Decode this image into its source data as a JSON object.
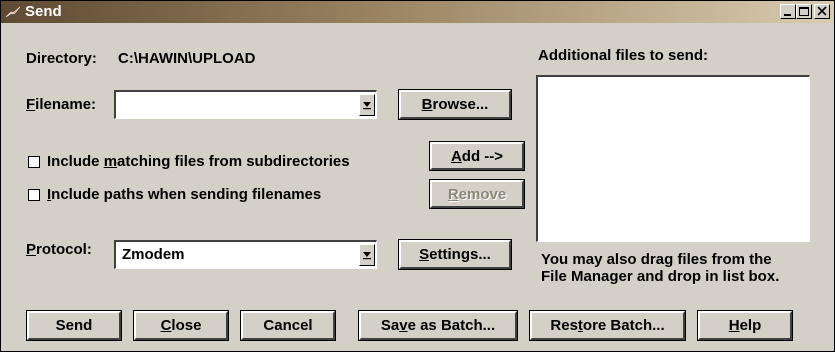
{
  "window": {
    "title": "Send",
    "controls": [
      "minimize",
      "maximize",
      "close"
    ]
  },
  "directory": {
    "label": "Directory:",
    "value": "C:\\HAWIN\\UPLOAD"
  },
  "filename": {
    "label_mnemonic": "F",
    "label_rest": "ilename:",
    "value": ""
  },
  "buttons": {
    "browse": {
      "m": "B",
      "rest": "rowse..."
    },
    "add": {
      "m": "A",
      "rest": "dd -->"
    },
    "remove": {
      "m": "R",
      "rest": "emove"
    },
    "settings": {
      "m": "S",
      "rest": "ettings..."
    }
  },
  "options": {
    "matching": {
      "pre": "Include ",
      "m": "m",
      "rest": "atching files from subdirectories",
      "checked": false
    },
    "paths": {
      "pre": "",
      "m": "I",
      "rest": "nclude paths when sending filenames",
      "checked": false
    }
  },
  "protocol": {
    "label_mnemonic": "P",
    "label_rest": "rotocol:",
    "value": "Zmodem"
  },
  "additional": {
    "label": "Additional files to send:",
    "items": [],
    "hint_line1": "You may also drag files from the",
    "hint_line2": "File Manager and drop in list box."
  },
  "bottom": {
    "send": "Send",
    "close": {
      "m": "C",
      "rest": "lose"
    },
    "cancel": "Cancel",
    "save_batch": {
      "pre": "Sa",
      "m": "v",
      "rest": "e as Batch..."
    },
    "restore_batch": {
      "pre": "Res",
      "m": "t",
      "rest": "ore Batch..."
    },
    "help": {
      "m": "H",
      "rest": "elp"
    }
  }
}
